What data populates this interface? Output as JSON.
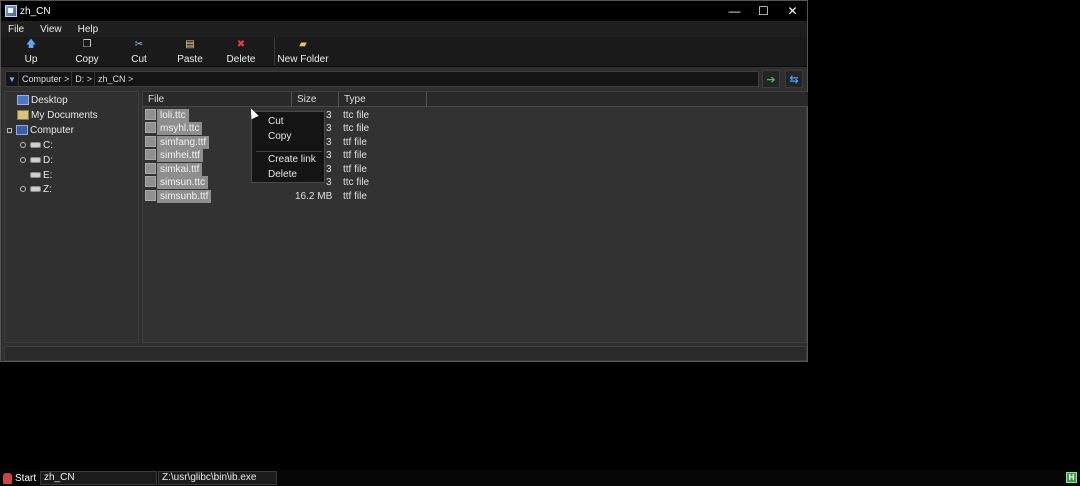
{
  "window": {
    "title": "zh_CN",
    "controls": {
      "minimize": "—",
      "maximize": "☐",
      "close": "✕"
    }
  },
  "menubar": {
    "items": [
      "File",
      "View",
      "Help"
    ]
  },
  "toolbar": {
    "buttons": [
      {
        "label": "Up",
        "icon": "up-arrow-icon",
        "glyph": "🡅",
        "color": "#5aa8ff"
      },
      {
        "label": "Copy",
        "icon": "copy-icon",
        "glyph": "❐",
        "color": "#dddddd"
      },
      {
        "label": "Cut",
        "icon": "scissors-icon",
        "glyph": "✂",
        "color": "#9cc0ff"
      },
      {
        "label": "Paste",
        "icon": "paste-icon",
        "glyph": "▤",
        "color": "#f0dca0"
      },
      {
        "label": "Delete",
        "icon": "delete-icon",
        "glyph": "✖",
        "color": "#e04040"
      },
      {
        "label": "New Folder",
        "icon": "folder-icon",
        "glyph": "▰",
        "color": "#e8c94a"
      }
    ]
  },
  "address": {
    "crumbs": [
      "Computer >",
      "D: >",
      "zh_CN >"
    ],
    "go_icon": "go-arrow-icon",
    "refresh_icon": "refresh-icon",
    "go_glyph": "➔",
    "refresh_glyph": "⇆",
    "go_color": "#2fd24a",
    "refresh_color": "#4aa3ff"
  },
  "tree": {
    "desktop": "Desktop",
    "documents": "My Documents",
    "computer": "Computer",
    "drives": [
      "C:",
      "D:",
      "E:",
      "Z:"
    ]
  },
  "filelist": {
    "columns": {
      "file": "File",
      "size": "Size",
      "type": "Type"
    },
    "rows": [
      {
        "name": "loli.ttc",
        "size": "3",
        "type": "ttc file"
      },
      {
        "name": "msyhl.ttc",
        "size": "3",
        "type": "ttc file"
      },
      {
        "name": "simfang.ttf",
        "size": "3",
        "type": "ttf file"
      },
      {
        "name": "simhei.ttf",
        "size": "3",
        "type": "ttf file"
      },
      {
        "name": "simkai.ttf",
        "size": "3",
        "type": "ttf file"
      },
      {
        "name": "simsun.ttc",
        "size": "3",
        "type": "ttc file"
      },
      {
        "name": "simsunb.ttf",
        "size": "16.2 MB",
        "type": "ttf file"
      }
    ]
  },
  "context_menu": {
    "items": [
      "Cut",
      "Copy",
      "Create link",
      "Delete"
    ]
  },
  "taskbar": {
    "start": "Start",
    "tasks": [
      "zh_CN",
      "Z:\\usr\\glibc\\bin\\ib.exe"
    ],
    "tray_icon": "tray-h-icon",
    "tray_glyph": "H"
  }
}
